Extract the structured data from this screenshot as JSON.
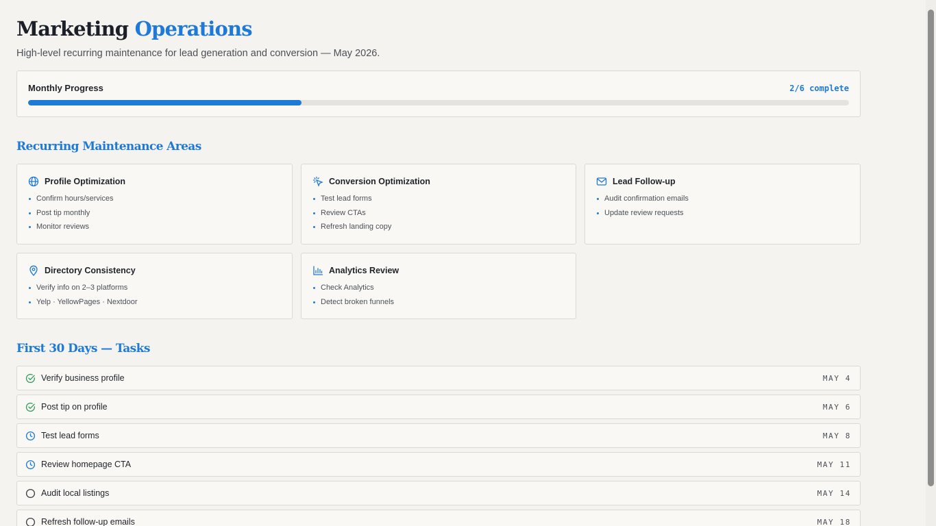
{
  "header": {
    "title_main": "Marketing",
    "title_accent": "Operations",
    "subtitle": "High-level recurring maintenance for lead generation and conversion — May 2026."
  },
  "progress": {
    "label": "Monthly Progress",
    "count_text": "2/6 complete",
    "completed": 2,
    "total": 6,
    "accent_color": "#1e7ad6"
  },
  "maintenance": {
    "heading": "Recurring Maintenance Areas",
    "cards": [
      {
        "title": "Profile Optimization",
        "icon": "globe-icon",
        "items": [
          "Confirm hours/services",
          "Post tip monthly",
          "Monitor reviews"
        ]
      },
      {
        "title": "Conversion Optimization",
        "icon": "cursor-click-icon",
        "items": [
          "Test lead forms",
          "Review CTAs",
          "Refresh landing copy"
        ]
      },
      {
        "title": "Lead Follow-up",
        "icon": "mail-icon",
        "items": [
          "Audit confirmation emails",
          "Update review requests"
        ]
      },
      {
        "title": "Directory Consistency",
        "icon": "map-pin-icon",
        "items": [
          "Verify info on 2–3 platforms",
          "Yelp · YellowPages · Nextdoor"
        ]
      },
      {
        "title": "Analytics Review",
        "icon": "bar-chart-icon",
        "items": [
          "Check Analytics",
          "Detect broken funnels"
        ]
      }
    ]
  },
  "tasks": {
    "heading": "First 30 Days — Tasks",
    "items": [
      {
        "label": "Verify business profile",
        "date": "MAY 4",
        "status": "done",
        "icon": "check-circle-icon"
      },
      {
        "label": "Post tip on profile",
        "date": "MAY 6",
        "status": "done",
        "icon": "check-circle-icon"
      },
      {
        "label": "Test lead forms",
        "date": "MAY 8",
        "status": "in-progress",
        "icon": "clock-icon"
      },
      {
        "label": "Review homepage CTA",
        "date": "MAY 11",
        "status": "in-progress",
        "icon": "clock-icon"
      },
      {
        "label": "Audit local listings",
        "date": "MAY 14",
        "status": "pending",
        "icon": "circle-icon"
      },
      {
        "label": "Refresh follow-up emails",
        "date": "MAY 18",
        "status": "pending",
        "icon": "circle-icon"
      }
    ]
  },
  "colors": {
    "accent": "#1e7ad6",
    "done": "#2e9e5b",
    "pending": "#3a3f46"
  }
}
